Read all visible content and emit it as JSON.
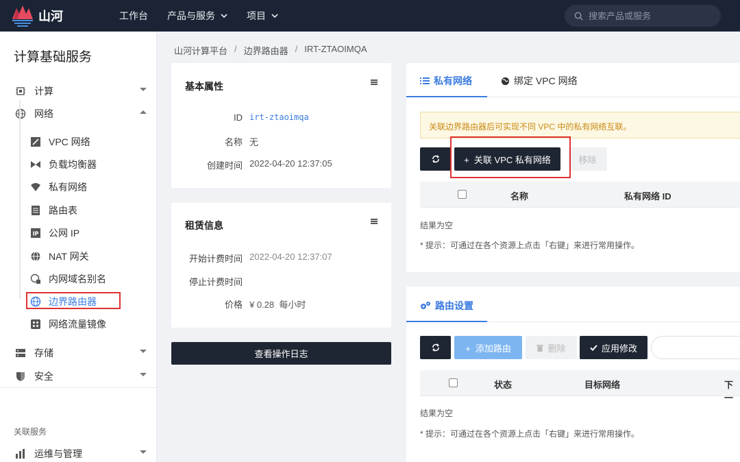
{
  "topbar": {
    "brand": "山河",
    "nav": [
      {
        "label": "工作台"
      },
      {
        "label": "产品与服务"
      },
      {
        "label": "项目"
      }
    ],
    "search_placeholder": "搜索产品或服务"
  },
  "sidebar": {
    "title": "计算基础服务",
    "groups": [
      {
        "label": "计算"
      },
      {
        "label": "网络"
      },
      {
        "label": "存储"
      },
      {
        "label": "安全"
      }
    ],
    "network_items": [
      {
        "label": "VPC 网络"
      },
      {
        "label": "负载均衡器"
      },
      {
        "label": "私有网络"
      },
      {
        "label": "路由表"
      },
      {
        "label": "公网 IP"
      },
      {
        "label": "NAT 网关"
      },
      {
        "label": "内网域名别名"
      },
      {
        "label": "边界路由器"
      },
      {
        "label": "网络流量镜像"
      }
    ],
    "related_title": "关联服务",
    "related_item": "运维与管理"
  },
  "breadcrumb": [
    "山河计算平台",
    "边界路由器",
    "IRT-ZTAOIMQA"
  ],
  "basic": {
    "title": "基本属性",
    "rows": [
      {
        "k": "ID",
        "v": "irt-ztaoimqa"
      },
      {
        "k": "名称",
        "v": "无"
      },
      {
        "k": "创建时间",
        "v": "2022-04-20 12:37:05"
      }
    ]
  },
  "lease": {
    "title": "租赁信息",
    "rows": [
      {
        "k": "开始计费时间",
        "v": "2022-04-20 12:37:07"
      },
      {
        "k": "停止计费时间",
        "v": ""
      },
      {
        "k": "价格",
        "v": "¥ 0.28  每小时"
      }
    ]
  },
  "log_button": "查看操作日志",
  "vpc_panel": {
    "tabs": [
      {
        "label": "私有网络"
      },
      {
        "label": "绑定 VPC 网络"
      }
    ],
    "alert": "关联边界路由器后可实现不同 VPC 中的私有网络互联。",
    "associate_button": "+  关联 VPC 私有网络",
    "remove_button": "移除",
    "columns": [
      "名称",
      "私有网络 ID"
    ],
    "empty": "结果为空",
    "hint": "* 提示：可通过在各个资源上点击「右键」来进行常用操作。"
  },
  "route_panel": {
    "title": "路由设置",
    "add_button": "+  添加路由",
    "delete_button": "删除",
    "apply_button": "应用修改",
    "columns": [
      "状态",
      "目标网络",
      "下一"
    ],
    "empty": "结果为空",
    "hint": "* 提示：可通过在各个资源上点击「右键」来进行常用操作。"
  },
  "colors": {
    "accent": "#3a7be0",
    "topbar": "#1b2434",
    "highlight": "#e03030"
  }
}
